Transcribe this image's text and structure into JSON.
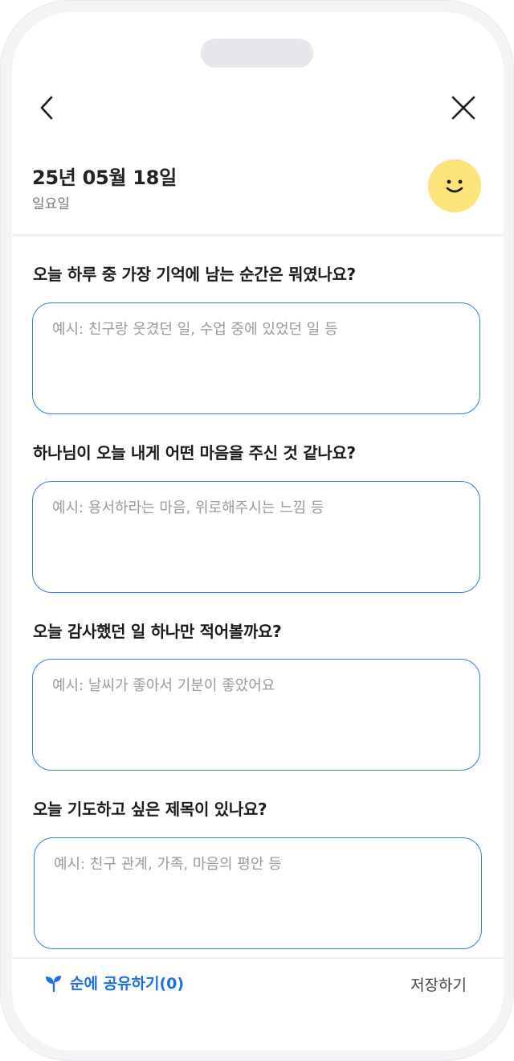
{
  "header": {
    "back_icon": "chevron-left-icon",
    "close_icon": "close-icon"
  },
  "entry": {
    "date": "25년 05월 18일",
    "weekday": "일요일",
    "mood_icon": "smiley-face-icon",
    "mood_color": "#fde37a"
  },
  "questions": [
    {
      "title": "오늘 하루 중 가장 기억에 남는 순간은 뭐였나요?",
      "placeholder": "예시: 친구랑 웃겼던 일, 수업 중에 있었던 일 등",
      "value": ""
    },
    {
      "title": "하나님이 오늘 내게 어떤 마음을 주신 것 같나요?",
      "placeholder": "예시: 용서하라는 마음, 위로해주시는 느낌 등",
      "value": ""
    },
    {
      "title": "오늘 감사했던 일 하나만 적어볼까요?",
      "placeholder": "예시: 날씨가 좋아서 기분이 좋았어요",
      "value": ""
    },
    {
      "title": "오늘 기도하고 싶은 제목이 있나요?",
      "placeholder": "예시: 친구 관계, 가족, 마음의 평안 등",
      "value": ""
    }
  ],
  "footer": {
    "share_label": "순에 공유하기(0)",
    "share_icon": "sprout-icon",
    "save_label": "저장하기"
  },
  "colors": {
    "accent": "#2f7ee6",
    "share_text": "#1f6fe0"
  }
}
